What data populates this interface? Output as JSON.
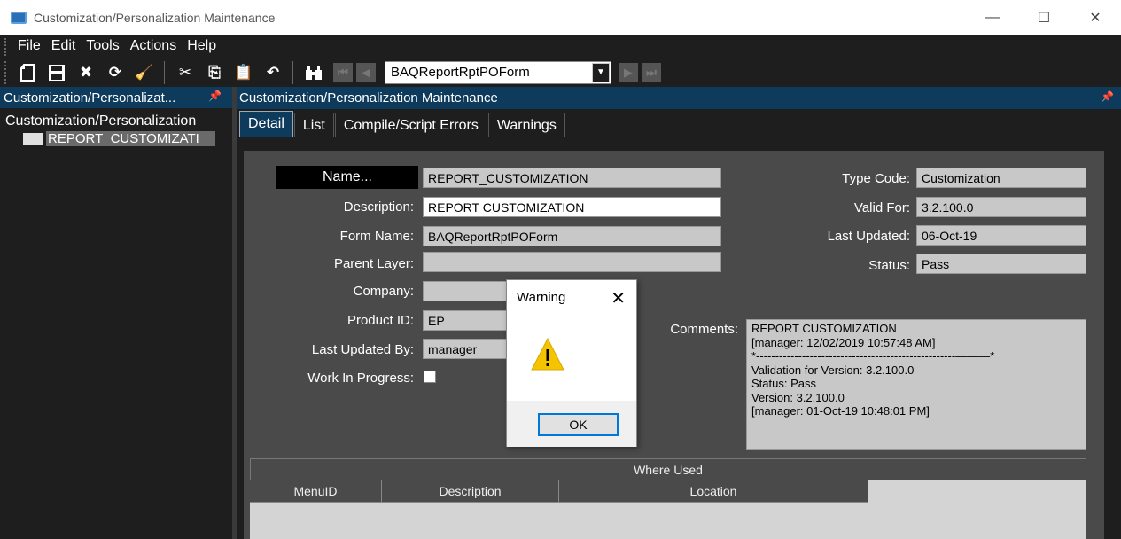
{
  "window": {
    "title": "Customization/Personalization Maintenance",
    "minimize": "—",
    "maximize": "☐",
    "close": "✕"
  },
  "menu": [
    "File",
    "Edit",
    "Tools",
    "Actions",
    "Help"
  ],
  "toolbar": {
    "form_selector_value": "BAQReportRptPOForm"
  },
  "tree": {
    "header": "Customization/Personalizat...",
    "root": "Customization/Personalization",
    "child": "REPORT_CUSTOMIZATI"
  },
  "main": {
    "header": "Customization/Personalization Maintenance",
    "tabs": [
      "Detail",
      "List",
      "Compile/Script Errors",
      "Warnings"
    ],
    "active_tab": "Detail"
  },
  "form": {
    "name_label": "Name...",
    "name_value": "REPORT_CUSTOMIZATION",
    "description_label": "Description:",
    "description_value": "REPORT CUSTOMIZATION",
    "form_name_label": "Form Name:",
    "form_name_value": "BAQReportRptPOForm",
    "parent_layer_label": "Parent Layer:",
    "parent_layer_value": "",
    "company_label": "Company:",
    "company_value": "",
    "product_id_label": "Product ID:",
    "product_id_value": "EP",
    "last_updated_by_label": "Last Updated By:",
    "last_updated_by_value": "manager",
    "wip_label": "Work In Progress:",
    "wip_checked": false,
    "type_code_label": "Type Code:",
    "type_code_value": "Customization",
    "valid_for_label": "Valid For:",
    "valid_for_value": "3.2.100.0",
    "last_updated_label": "Last Updated:",
    "last_updated_value": "06-Oct-19",
    "status_label": "Status:",
    "status_value": "Pass",
    "comments_label": "Comments:",
    "comments_lines": [
      "REPORT CUSTOMIZATION",
      "[manager: 12/02/2019 10:57:48 AM]",
      "",
      "*----------------------------------------------------———*",
      "Validation for Version: 3.2.100.0",
      "Status: Pass",
      "Version: 3.2.100.0",
      "",
      "[manager: 01-Oct-19 10:48:01 PM]"
    ]
  },
  "where_used": {
    "title": "Where Used",
    "columns": [
      "MenuID",
      "Description",
      "Location"
    ]
  },
  "dialog": {
    "title": "Warning",
    "close": "✕",
    "ok_label": "OK",
    "icon": "warning-icon"
  },
  "colors": {
    "header_blue": "#0e3a5c",
    "dark_bg": "#1e1e1e",
    "form_bg": "#4a4a4a",
    "ok_border": "#0078d7",
    "warning_yellow": "#f5c400"
  }
}
